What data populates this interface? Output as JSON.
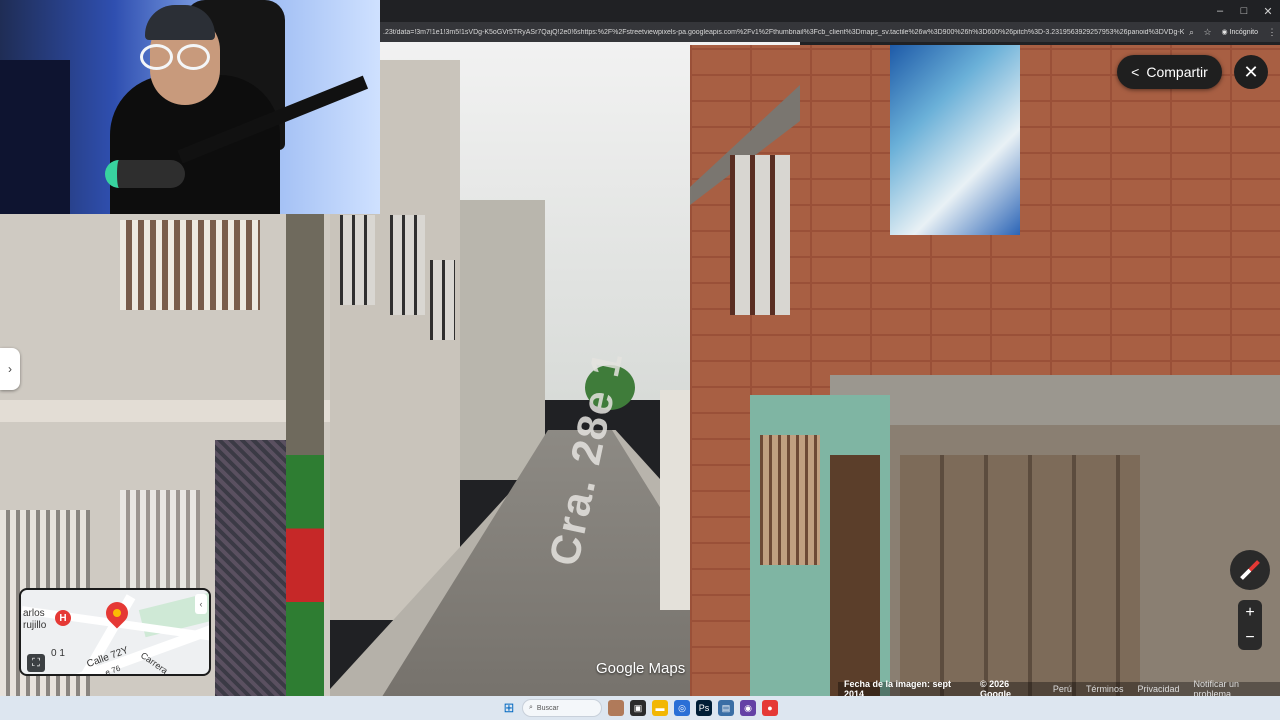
{
  "browser": {
    "url": ".23t/data=!3m7!1e1!3m5!1sVDg-K5oGVr5TRyASr7QajQ!2e0!6shttps:%2F%2Fstreetviewpixels-pa.googleapis.com%2Fv1%2Fthumbnail%3Fcb_client%3Dmaps_sv.tactile%26w%3D900%26h%3D600%26pitch%3D-3.2319563929257953%26panoid%3DVDg-K...",
    "incognito_label": "Incógnito",
    "window_controls": [
      "–",
      "□",
      "✕"
    ]
  },
  "street_view": {
    "share_label": "Compartir",
    "close_symbol": "✕",
    "road_marking": "Cra. 28e 1",
    "brand": "Google Maps",
    "zoom_in": "+",
    "zoom_out": "−"
  },
  "minimap": {
    "labels": {
      "place_name_line1": "arlos",
      "place_name_line2": "rujillo",
      "number_label": "0 1",
      "street1": "Calle 72Y",
      "street2": "Carrera",
      "street3": "e 76"
    },
    "hospital_marker": "H"
  },
  "footer": {
    "image_date": "Fecha de la imagen: sept 2014",
    "copyright": "© 2026 Google",
    "country": "Perú",
    "terms": "Términos",
    "privacy": "Privacidad",
    "report": "Notificar un problema"
  },
  "taskbar": {
    "search_placeholder": "Buscar"
  },
  "colors": {
    "brick": "#a85f43",
    "chrome_dark": "#202124",
    "taskbar": "#dde6f0"
  }
}
